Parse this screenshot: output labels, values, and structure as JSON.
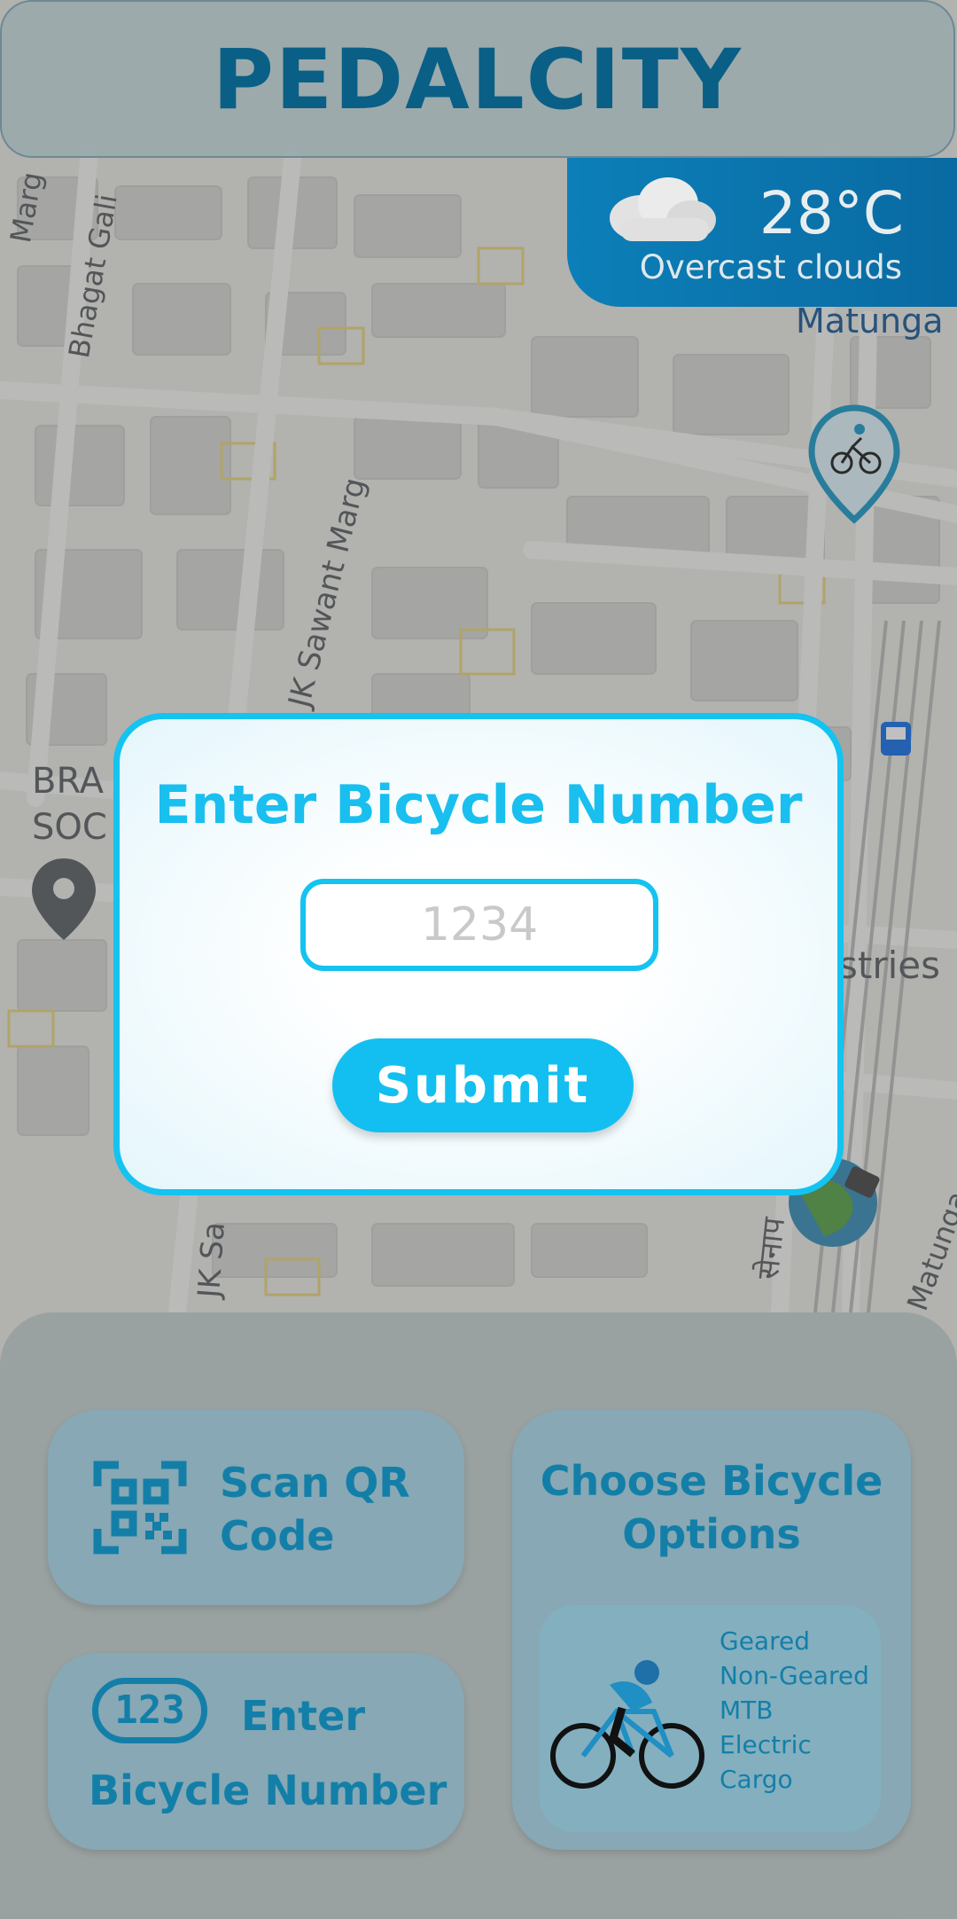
{
  "app": {
    "title": "PEDALCITY"
  },
  "weather": {
    "temperature": "28°C",
    "description": "Overcast clouds",
    "icon": "cloud-icon"
  },
  "map": {
    "labels": {
      "bhagat_gali": "Bhagat Gali",
      "jk_sawant_marg": "JK Sawant Marg",
      "jk_sa": "JK Sa",
      "matunga": "Matunga",
      "matunga_road": "Matunga",
      "marg": "Marg",
      "bra": "BRA",
      "soc": "SOC",
      "stries": "stries",
      "senapati": "सेनाप"
    }
  },
  "modal": {
    "title": "Enter Bicycle Number",
    "input_placeholder": "1234",
    "input_value": "",
    "submit_label": "Submit"
  },
  "actions": {
    "scan_qr_label": "Scan QR Code",
    "enter_number_label_1": "Enter",
    "enter_number_label_2": "Bicycle Number",
    "enter_number_icon_text": "123",
    "choose_options_title": "Choose Bicycle Options",
    "bicycle_options": [
      "Geared",
      "Non-Geared",
      "MTB",
      "Electric",
      "Cargo"
    ]
  },
  "colors": {
    "accent": "#14c3f0",
    "brand_dark": "#0a5f86",
    "panel_text": "#137fa8",
    "weather_bg": "#0c7fb8"
  }
}
